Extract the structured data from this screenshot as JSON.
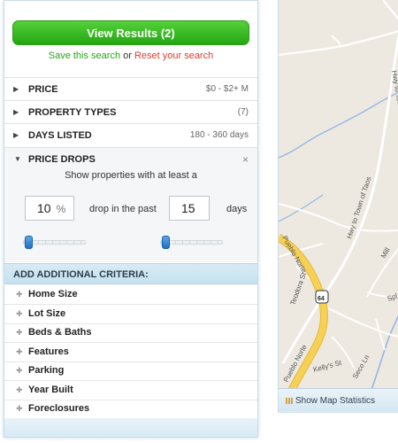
{
  "filters": {
    "view_results_label": "View Results (2)",
    "save_search_label": "Save this search",
    "or_text": "or",
    "reset_search_label": "Reset your search",
    "rows": [
      {
        "label": "PRICE",
        "value": "$0 - $2+ M"
      },
      {
        "label": "PROPERTY TYPES",
        "value": "(7)"
      },
      {
        "label": "DAYS LISTED",
        "value": "180 - 360 days"
      }
    ],
    "price_drops": {
      "label": "PRICE DROPS",
      "close_icon": "×",
      "description": "Show properties with at least a",
      "percent_value": "10",
      "percent_unit": "%",
      "middle_text": "drop in the past",
      "days_value": "15",
      "days_unit": "days",
      "percent_slider_position": 0,
      "days_slider_position": 0
    },
    "additional_header": "ADD ADDITIONAL CRITERIA:",
    "criteria": [
      "Home Size",
      "Lot Size",
      "Beds & Baths",
      "Features",
      "Parking",
      "Year Built",
      "Foreclosures"
    ]
  },
  "map": {
    "road_labels": [
      "Hwy to Town of Taos",
      "Hwy to Town of Taos",
      "Pueblo Norte",
      "Pueblo Norte",
      "Teodora St",
      "Mill",
      "Spl",
      "Seco Ln",
      "Kelly's St"
    ],
    "route_number": "64",
    "stats_label": "Show Map Statistics",
    "stats_icon": "bar-chart-icon",
    "colors": {
      "land": "#ede9e1",
      "road": "#ffffff",
      "highway": "#f6d155",
      "water": "#93b6e4"
    }
  }
}
